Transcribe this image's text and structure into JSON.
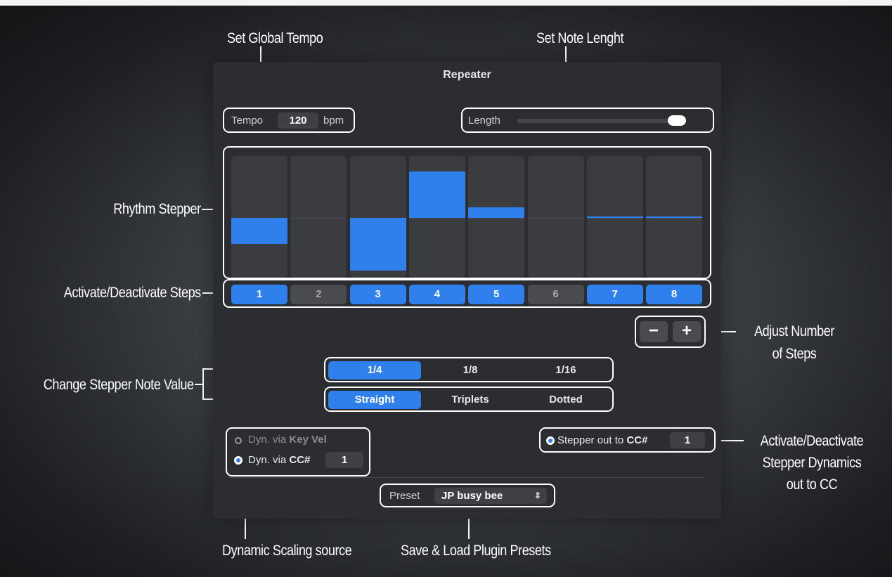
{
  "annotations": {
    "set_global_tempo": "Set Global Tempo",
    "set_note_length": "Set Note Lenght",
    "rhythm_stepper": "Rhythm Stepper",
    "activate_steps": "Activate/Deactivate Steps",
    "adjust_steps_1": "Adjust Number",
    "adjust_steps_2": "of Steps",
    "change_note_value": "Change Stepper Note Value",
    "activate_dynamics_1": "Activate/Deactivate",
    "activate_dynamics_2": "Stepper Dynamics",
    "activate_dynamics_3": "out to CC",
    "dynamic_scaling": "Dynamic Scaling source",
    "presets": "Save & Load Plugin Presets"
  },
  "plugin": {
    "title": "Repeater",
    "tempo": {
      "label": "Tempo",
      "value": "120",
      "unit": "bpm"
    },
    "length": {
      "label": "Length",
      "value_fraction": 1.0
    },
    "stepper": {
      "steps": [
        {
          "label": "1",
          "active": true,
          "value": -0.42
        },
        {
          "label": "2",
          "active": false,
          "value": 0
        },
        {
          "label": "3",
          "active": true,
          "value": -0.85
        },
        {
          "label": "4",
          "active": true,
          "value": 0.75
        },
        {
          "label": "5",
          "active": true,
          "value": 0.17
        },
        {
          "label": "6",
          "active": false,
          "value": 0
        },
        {
          "label": "7",
          "active": true,
          "value": 0.01
        },
        {
          "label": "8",
          "active": true,
          "value": 0.01
        }
      ],
      "minus_label": "−",
      "plus_label": "+"
    },
    "note_value": {
      "options": [
        "1/4",
        "1/8",
        "1/16"
      ],
      "selected": "1/4"
    },
    "note_type": {
      "options": [
        "Straight",
        "Triplets",
        "Dotted"
      ],
      "selected": "Straight"
    },
    "dynamics": {
      "key_vel_prefix": "Dyn. via ",
      "key_vel_bold": "Key Vel",
      "cc_prefix": "Dyn. via ",
      "cc_bold": "CC#",
      "cc_value": "1",
      "selected": "cc"
    },
    "stepper_out": {
      "prefix": "Stepper out to ",
      "bold": "CC#",
      "value": "1",
      "enabled": true
    },
    "preset": {
      "label": "Preset",
      "value": "JP busy bee"
    },
    "colors": {
      "accent": "#2f80ed",
      "panel": "#2c2d30"
    }
  }
}
